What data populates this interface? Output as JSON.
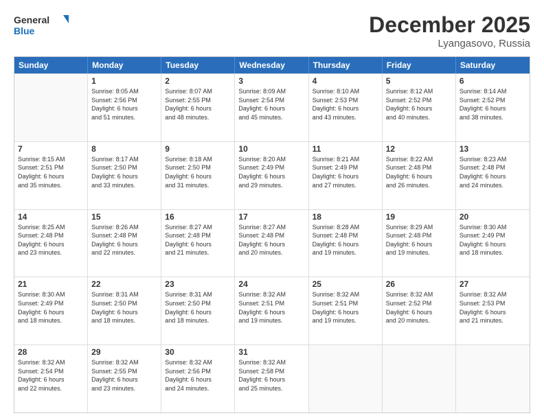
{
  "header": {
    "logo_line1": "General",
    "logo_line2": "Blue",
    "month": "December 2025",
    "location": "Lyangasovo, Russia"
  },
  "weekdays": [
    "Sunday",
    "Monday",
    "Tuesday",
    "Wednesday",
    "Thursday",
    "Friday",
    "Saturday"
  ],
  "rows": [
    [
      {
        "day": "",
        "info": ""
      },
      {
        "day": "1",
        "info": "Sunrise: 8:05 AM\nSunset: 2:56 PM\nDaylight: 6 hours\nand 51 minutes."
      },
      {
        "day": "2",
        "info": "Sunrise: 8:07 AM\nSunset: 2:55 PM\nDaylight: 6 hours\nand 48 minutes."
      },
      {
        "day": "3",
        "info": "Sunrise: 8:09 AM\nSunset: 2:54 PM\nDaylight: 6 hours\nand 45 minutes."
      },
      {
        "day": "4",
        "info": "Sunrise: 8:10 AM\nSunset: 2:53 PM\nDaylight: 6 hours\nand 43 minutes."
      },
      {
        "day": "5",
        "info": "Sunrise: 8:12 AM\nSunset: 2:52 PM\nDaylight: 6 hours\nand 40 minutes."
      },
      {
        "day": "6",
        "info": "Sunrise: 8:14 AM\nSunset: 2:52 PM\nDaylight: 6 hours\nand 38 minutes."
      }
    ],
    [
      {
        "day": "7",
        "info": "Sunrise: 8:15 AM\nSunset: 2:51 PM\nDaylight: 6 hours\nand 35 minutes."
      },
      {
        "day": "8",
        "info": "Sunrise: 8:17 AM\nSunset: 2:50 PM\nDaylight: 6 hours\nand 33 minutes."
      },
      {
        "day": "9",
        "info": "Sunrise: 8:18 AM\nSunset: 2:50 PM\nDaylight: 6 hours\nand 31 minutes."
      },
      {
        "day": "10",
        "info": "Sunrise: 8:20 AM\nSunset: 2:49 PM\nDaylight: 6 hours\nand 29 minutes."
      },
      {
        "day": "11",
        "info": "Sunrise: 8:21 AM\nSunset: 2:49 PM\nDaylight: 6 hours\nand 27 minutes."
      },
      {
        "day": "12",
        "info": "Sunrise: 8:22 AM\nSunset: 2:48 PM\nDaylight: 6 hours\nand 26 minutes."
      },
      {
        "day": "13",
        "info": "Sunrise: 8:23 AM\nSunset: 2:48 PM\nDaylight: 6 hours\nand 24 minutes."
      }
    ],
    [
      {
        "day": "14",
        "info": "Sunrise: 8:25 AM\nSunset: 2:48 PM\nDaylight: 6 hours\nand 23 minutes."
      },
      {
        "day": "15",
        "info": "Sunrise: 8:26 AM\nSunset: 2:48 PM\nDaylight: 6 hours\nand 22 minutes."
      },
      {
        "day": "16",
        "info": "Sunrise: 8:27 AM\nSunset: 2:48 PM\nDaylight: 6 hours\nand 21 minutes."
      },
      {
        "day": "17",
        "info": "Sunrise: 8:27 AM\nSunset: 2:48 PM\nDaylight: 6 hours\nand 20 minutes."
      },
      {
        "day": "18",
        "info": "Sunrise: 8:28 AM\nSunset: 2:48 PM\nDaylight: 6 hours\nand 19 minutes."
      },
      {
        "day": "19",
        "info": "Sunrise: 8:29 AM\nSunset: 2:48 PM\nDaylight: 6 hours\nand 19 minutes."
      },
      {
        "day": "20",
        "info": "Sunrise: 8:30 AM\nSunset: 2:49 PM\nDaylight: 6 hours\nand 18 minutes."
      }
    ],
    [
      {
        "day": "21",
        "info": "Sunrise: 8:30 AM\nSunset: 2:49 PM\nDaylight: 6 hours\nand 18 minutes."
      },
      {
        "day": "22",
        "info": "Sunrise: 8:31 AM\nSunset: 2:50 PM\nDaylight: 6 hours\nand 18 minutes."
      },
      {
        "day": "23",
        "info": "Sunrise: 8:31 AM\nSunset: 2:50 PM\nDaylight: 6 hours\nand 18 minutes."
      },
      {
        "day": "24",
        "info": "Sunrise: 8:32 AM\nSunset: 2:51 PM\nDaylight: 6 hours\nand 19 minutes."
      },
      {
        "day": "25",
        "info": "Sunrise: 8:32 AM\nSunset: 2:51 PM\nDaylight: 6 hours\nand 19 minutes."
      },
      {
        "day": "26",
        "info": "Sunrise: 8:32 AM\nSunset: 2:52 PM\nDaylight: 6 hours\nand 20 minutes."
      },
      {
        "day": "27",
        "info": "Sunrise: 8:32 AM\nSunset: 2:53 PM\nDaylight: 6 hours\nand 21 minutes."
      }
    ],
    [
      {
        "day": "28",
        "info": "Sunrise: 8:32 AM\nSunset: 2:54 PM\nDaylight: 6 hours\nand 22 minutes."
      },
      {
        "day": "29",
        "info": "Sunrise: 8:32 AM\nSunset: 2:55 PM\nDaylight: 6 hours\nand 23 minutes."
      },
      {
        "day": "30",
        "info": "Sunrise: 8:32 AM\nSunset: 2:56 PM\nDaylight: 6 hours\nand 24 minutes."
      },
      {
        "day": "31",
        "info": "Sunrise: 8:32 AM\nSunset: 2:58 PM\nDaylight: 6 hours\nand 25 minutes."
      },
      {
        "day": "",
        "info": ""
      },
      {
        "day": "",
        "info": ""
      },
      {
        "day": "",
        "info": ""
      }
    ]
  ]
}
